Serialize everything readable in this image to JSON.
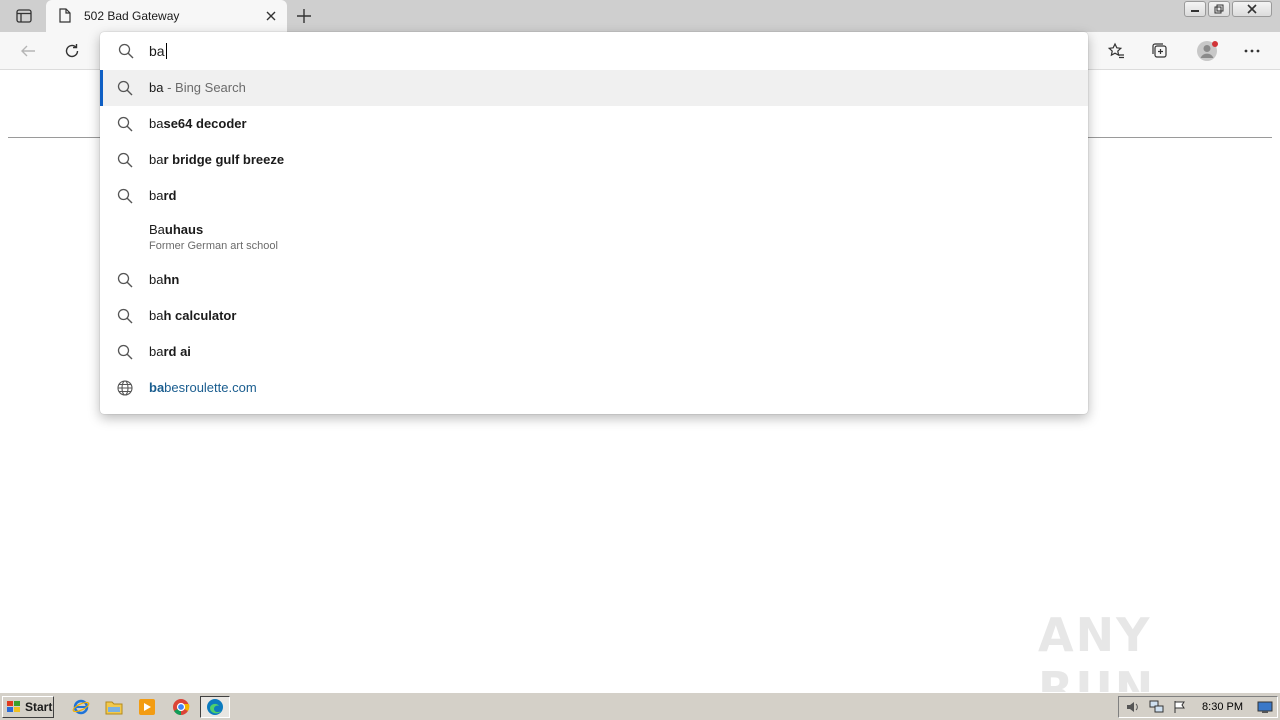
{
  "browser": {
    "tab": {
      "title": "502 Bad Gateway"
    }
  },
  "omnibox": {
    "query": "ba",
    "suggestions": [
      {
        "type": "search",
        "typed": "ba",
        "completion": "",
        "aux": " - Bing Search",
        "selected": true
      },
      {
        "type": "search",
        "typed": "ba",
        "completion": "se64 decoder"
      },
      {
        "type": "search",
        "typed": "ba",
        "completion": "r bridge gulf breeze"
      },
      {
        "type": "search",
        "typed": "ba",
        "completion": "rd"
      },
      {
        "type": "entity",
        "typed": "Ba",
        "completion": "uhaus",
        "subtitle": "Former German art school"
      },
      {
        "type": "search",
        "typed": "ba",
        "completion": "hn"
      },
      {
        "type": "search",
        "typed": "ba",
        "completion": "h calculator"
      },
      {
        "type": "search",
        "typed": "ba",
        "completion": "rd ai"
      },
      {
        "type": "url",
        "typed": "ba",
        "completion": "besroulette.com"
      }
    ]
  },
  "watermark": {
    "text": "ANY RUN"
  },
  "taskbar": {
    "start_label": "Start",
    "clock": "8:30 PM"
  },
  "colors": {
    "accent": "#0f5fc4",
    "url_text": "#1a5d8f",
    "profile_dot": "#d13438"
  }
}
